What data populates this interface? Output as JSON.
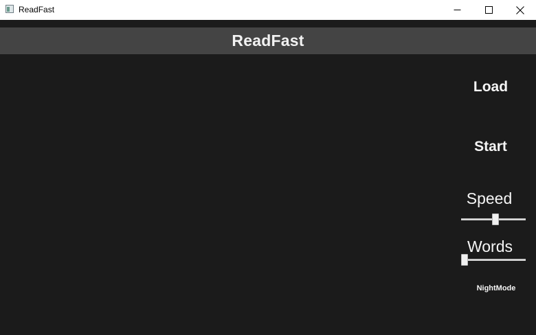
{
  "window": {
    "title": "ReadFast",
    "icon": "app-window-icon",
    "controls": [
      "minimize-icon",
      "maximize-icon",
      "close-icon"
    ]
  },
  "header": {
    "title": "ReadFast",
    "background": "#444444"
  },
  "controls": {
    "load_label": "Load",
    "start_label": "Start",
    "speed": {
      "label": "Speed",
      "value_fraction": 0.53
    },
    "words": {
      "label": "Words",
      "value_fraction": 0.0
    },
    "nightmode_label": "NightMode"
  },
  "colors": {
    "background": "#1b1b1b",
    "text": "#f5f5f5",
    "titlebar": "#ffffff"
  }
}
